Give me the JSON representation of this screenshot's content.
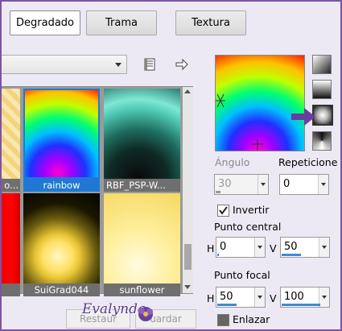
{
  "tabs": [
    {
      "label": "Degradado",
      "active": true
    },
    {
      "label": "Trama",
      "active": false
    },
    {
      "label": "Textura",
      "active": false
    }
  ],
  "gallery": {
    "items": [
      {
        "name": "",
        "visible_caption": "o..."
      },
      {
        "name": "rainbow",
        "selected": true
      },
      {
        "name": "RBF_PSP-W..."
      },
      {
        "name": ""
      },
      {
        "name": "SuiGrad044"
      },
      {
        "name": "sunflower"
      }
    ]
  },
  "controls": {
    "angle_label": "Ángulo",
    "angle_value": "30",
    "repeat_label": "Repeticione",
    "repeat_value": "0",
    "invert_label": "Invertir",
    "invert_checked": true,
    "center_label": "Punto central",
    "center_h_label": "H",
    "center_h_value": "0",
    "center_v_label": "V",
    "center_v_value": "50",
    "focal_label": "Punto focal",
    "focal_h_label": "H",
    "focal_h_value": "50",
    "focal_v_label": "V",
    "focal_v_value": "100",
    "link_label": "Enlazar",
    "link_checked": false
  },
  "footer": {
    "restore_label": "Restaur",
    "save_label": "uardar",
    "watermark": "Evalynda"
  },
  "colors": {
    "frame_border": "#7b54a6",
    "selection_blue": "#1f79d4",
    "arrow_purple": "#6a3ea0"
  }
}
